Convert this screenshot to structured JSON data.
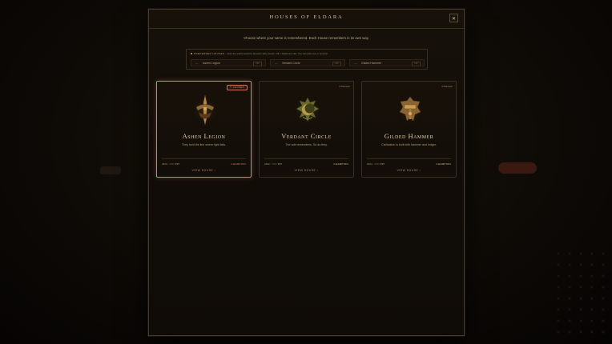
{
  "modal": {
    "title": "Houses of Eldara",
    "close_label": "✕",
    "subtitle": "Choose where your name is remembered. Each House remembers in its own way."
  },
  "preferences": {
    "label_key": "PREFERRED HOUSES",
    "label_text": "· Lean the world toward a House's side events. Off = balanced rolls. You can pick one or several.",
    "items": [
      {
        "dash": "—",
        "name": "Ashen Legion",
        "tag": "OFF"
      },
      {
        "dash": "—",
        "name": "Verdant Circle",
        "tag": "OFF"
      },
      {
        "dash": "—",
        "name": "Gilded Hammer",
        "tag": "OFF"
      }
    ]
  },
  "cards": [
    {
      "selected": true,
      "badge": "✦ CHOSEN",
      "name": "Ashen Legion",
      "desc": "They hold the line where light fails.",
      "stats_num": "3826",
      "stats_dim": "/ 6350",
      "stats_unit": "PLT",
      "tier": "CHAMPION",
      "view": "VIEW HOUSE ›",
      "emblem": "sword-crest-icon"
    },
    {
      "selected": false,
      "badge": "3 champion",
      "name": "Verdant Circle",
      "desc": "The wild remembers. So do they.",
      "stats_num": "3482",
      "stats_dim": "/ 6350",
      "stats_unit": "PLT",
      "tier": "CHAMPION",
      "view": "VIEW HOUSE ›",
      "emblem": "moon-crest-icon"
    },
    {
      "selected": false,
      "badge": "4 champion",
      "name": "Gilded Hammer",
      "desc": "Civilization is built with hammer and ledger.",
      "stats_num": "3024",
      "stats_dim": "/ 6350",
      "stats_unit": "PLT",
      "tier": "CHAMPION",
      "view": "VIEW HOUSE ›",
      "emblem": "hammer-crest-icon"
    }
  ]
}
